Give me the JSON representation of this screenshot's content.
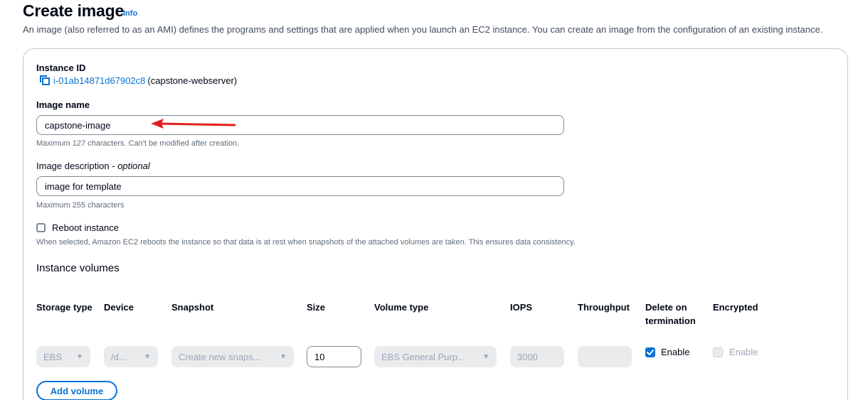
{
  "header": {
    "title": "Create image",
    "info_label": "Info",
    "description": "An image (also referred to as an AMI) defines the programs and settings that are applied when you launch an EC2 instance. You can create an image from the configuration of an existing instance."
  },
  "instance": {
    "label": "Instance ID",
    "id": "i-01ab14871d67902c8",
    "name": "(capstone-webserver)",
    "icon": "copy-icon"
  },
  "image_name": {
    "label": "Image name",
    "value": "capstone-image",
    "hint": "Maximum 127 characters. Can't be modified after creation."
  },
  "image_description": {
    "label": "Image description",
    "optional": "optional",
    "value": "image for template",
    "hint": "Maximum 255 characters"
  },
  "reboot": {
    "label": "Reboot instance",
    "checked": false,
    "hint": "When selected, Amazon EC2 reboots the instance so that data is at rest when snapshots of the attached volumes are taken. This ensures data consistency."
  },
  "volumes": {
    "title": "Instance volumes",
    "headers": {
      "storage_type": "Storage type",
      "device": "Device",
      "snapshot": "Snapshot",
      "size": "Size",
      "volume_type": "Volume type",
      "iops": "IOPS",
      "throughput": "Throughput",
      "delete_on_termination": "Delete on termination",
      "encrypted": "Encrypted"
    },
    "row": {
      "storage_type": "EBS",
      "device": "/d...",
      "snapshot": "Create new snaps...",
      "size": "10",
      "volume_type": "EBS General Purp...",
      "iops": "3000",
      "throughput": "",
      "delete_on_termination_label": "Enable",
      "delete_on_termination_checked": true,
      "encrypted_label": "Enable",
      "encrypted_checked": false
    },
    "add_button": "Add volume"
  },
  "colors": {
    "accent": "#0972d3",
    "annotation_arrow": "#e0201e",
    "disabled_bg": "#e9ebed"
  }
}
